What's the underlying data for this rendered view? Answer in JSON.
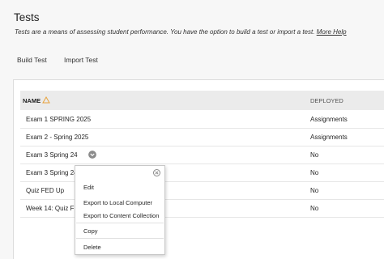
{
  "page": {
    "title": "Tests",
    "description": "Tests are a means of assessing student performance. You have the option to build a test or import a test.",
    "help_link": "More Help"
  },
  "actions": {
    "build": "Build Test",
    "import": "Import Test"
  },
  "table": {
    "columns": {
      "name": "NAME",
      "deployed": "DEPLOYED"
    },
    "rows": [
      {
        "name": "Exam 1 SPRING 2025",
        "deployed": "Assignments"
      },
      {
        "name": "Exam 2 - Spring 2025",
        "deployed": "Assignments"
      },
      {
        "name": "Exam 3 Spring 24",
        "deployed": "No"
      },
      {
        "name": "Exam 3 Spring 24(",
        "deployed": "No"
      },
      {
        "name": "Quiz FED Up",
        "deployed": "No"
      },
      {
        "name": "Week 14: Quiz FED",
        "deployed": "No"
      }
    ]
  },
  "context_menu": {
    "items": {
      "edit": "Edit",
      "export_local": "Export to Local Computer",
      "export_content": "Export to Content Collection",
      "copy": "Copy",
      "delete": "Delete"
    }
  },
  "icons": {
    "sort": "sort-triangle-icon",
    "options": "chevron-down-icon",
    "close": "close-icon"
  },
  "colors": {
    "sort_accent": "#e8a23c"
  }
}
